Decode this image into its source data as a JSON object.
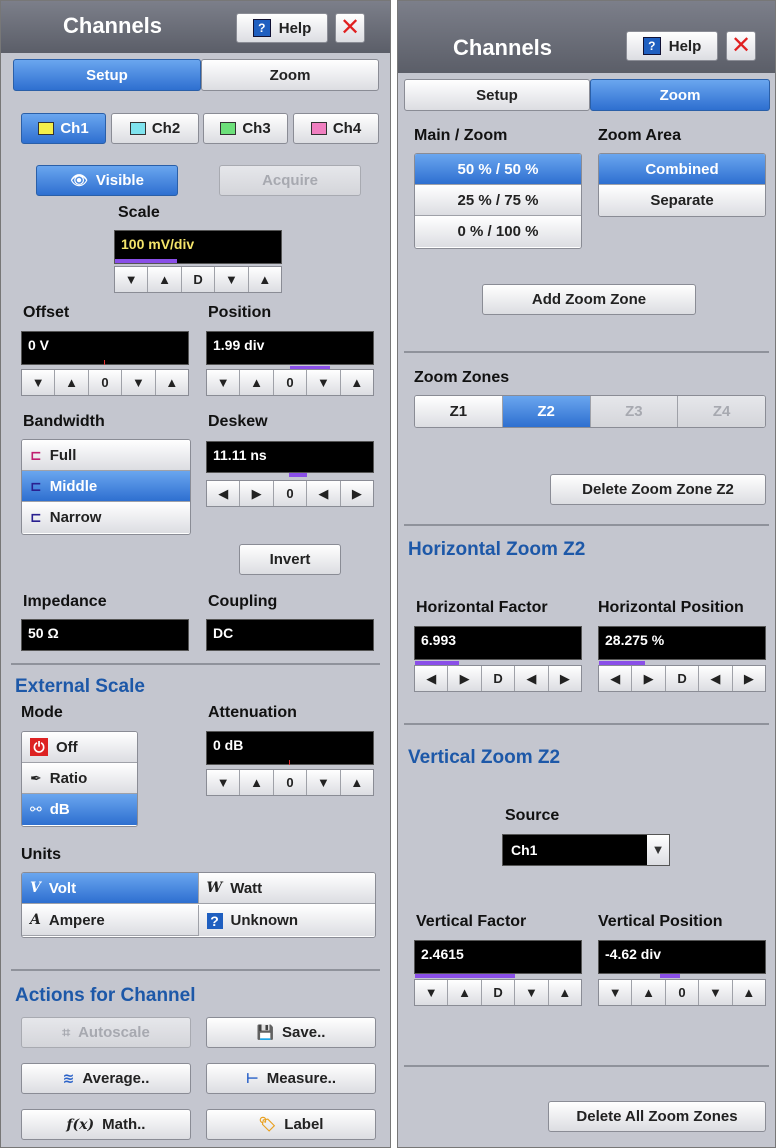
{
  "left_panel": {
    "title": "Channels",
    "help_label": "Help",
    "tabs": [
      {
        "label": "Setup",
        "selected": true
      },
      {
        "label": "Zoom",
        "selected": false
      }
    ],
    "channels": [
      {
        "label": "Ch1",
        "color": "#f5ef4a",
        "selected": true
      },
      {
        "label": "Ch2",
        "color": "#7fe3ee",
        "selected": false
      },
      {
        "label": "Ch3",
        "color": "#6ce07a",
        "selected": false
      },
      {
        "label": "Ch4",
        "color": "#f07fc0",
        "selected": false
      }
    ],
    "visible_label": "Visible",
    "acquire_label": "Acquire",
    "scale": {
      "label": "Scale",
      "value": "100 mV/div"
    },
    "offset": {
      "label": "Offset",
      "value": "0 V"
    },
    "position": {
      "label": "Position",
      "value": "1.99 div"
    },
    "bandwidth": {
      "label": "Bandwidth",
      "options": [
        "Full",
        "Middle",
        "Narrow"
      ],
      "selected": "Middle"
    },
    "deskew": {
      "label": "Deskew",
      "value": "11.11 ns"
    },
    "invert_label": "Invert",
    "impedance": {
      "label": "Impedance",
      "value": "50 Ω"
    },
    "coupling": {
      "label": "Coupling",
      "value": "DC"
    },
    "external_scale": {
      "title": "External Scale",
      "mode_label": "Mode",
      "modes": [
        "Off",
        "Ratio",
        "dB"
      ],
      "selected_mode": "dB",
      "attenuation": {
        "label": "Attenuation",
        "value": "0 dB"
      }
    },
    "units": {
      "label": "Units",
      "options": [
        {
          "glyph": "V",
          "label": "Volt",
          "selected": true
        },
        {
          "glyph": "W",
          "label": "Watt",
          "selected": false
        },
        {
          "glyph": "A",
          "label": "Ampere",
          "selected": false
        },
        {
          "glyph": "?",
          "label": "Unknown",
          "selected": false
        }
      ]
    },
    "actions": {
      "title": "Actions for Channel",
      "autoscale": "Autoscale",
      "save": "Save..",
      "average": "Average..",
      "measure": "Measure..",
      "math": "Math..",
      "label": "Label"
    },
    "arrow_glyphs": {
      "down": "▼",
      "up": "▲",
      "left": "◀",
      "right": "▶",
      "d": "D",
      "zero": "0"
    }
  },
  "right_panel": {
    "title": "Channels",
    "help_label": "Help",
    "tabs": [
      {
        "label": "Setup",
        "selected": false
      },
      {
        "label": "Zoom",
        "selected": true
      }
    ],
    "main_zoom": {
      "label": "Main / Zoom",
      "options": [
        "50 % / 50 %",
        "25 % / 75 %",
        "0 % / 100 %"
      ],
      "selected": "50 % / 50 %"
    },
    "zoom_area": {
      "label": "Zoom Area",
      "options": [
        "Combined",
        "Separate"
      ],
      "selected": "Combined"
    },
    "add_zoom_zone": "Add Zoom Zone",
    "zoom_zones": {
      "label": "Zoom Zones",
      "zones": [
        "Z1",
        "Z2",
        "Z3",
        "Z4"
      ],
      "selected": "Z2",
      "disabled": [
        "Z3",
        "Z4"
      ]
    },
    "delete_zone": "Delete Zoom Zone Z2",
    "horizontal": {
      "title": "Horizontal Zoom Z2",
      "factor_label": "Horizontal Factor",
      "factor_value": "6.993",
      "position_label": "Horizontal Position",
      "position_value": "28.275 %"
    },
    "vertical": {
      "title": "Vertical Zoom Z2",
      "source_label": "Source",
      "source_value": "Ch1",
      "factor_label": "Vertical Factor",
      "factor_value": "2.4615",
      "position_label": "Vertical Position",
      "position_value": "-4.62 div"
    },
    "delete_all": "Delete All Zoom Zones"
  },
  "colors": {
    "accent": "#2e6fd0",
    "section": "#1d58a8",
    "panel": "#c4c6cf"
  }
}
